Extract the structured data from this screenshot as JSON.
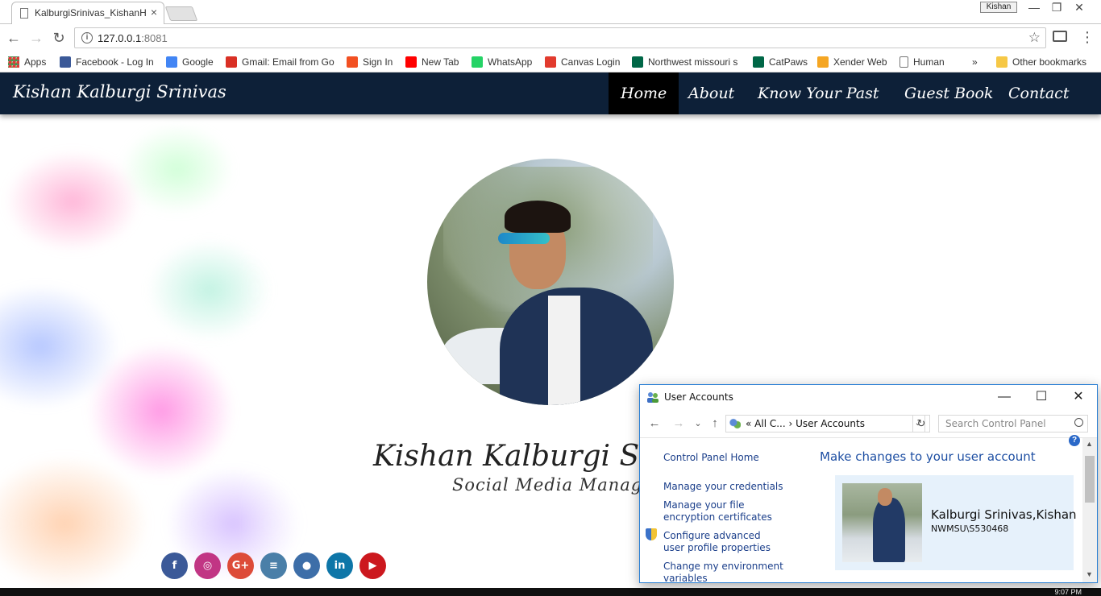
{
  "browser": {
    "tab_title": "KalburgiSrinivas_KishanH",
    "tab_close": "×",
    "profile_name": "Kishan",
    "window_controls": {
      "minimize": "—",
      "maximize": "❐",
      "close": "✕"
    },
    "nav": {
      "back": "←",
      "forward": "→",
      "reload": "↻"
    },
    "info_icon_glyph": "i",
    "url_host": "127.0.0.1",
    "url_port": ":8081",
    "star_glyph": "☆",
    "menu_glyph": "⋮",
    "bookmarks": [
      {
        "label": "Apps",
        "icon": "apps-grid-icon",
        "color": "#e53935"
      },
      {
        "label": "Facebook - Log In",
        "icon": "facebook-icon",
        "color": "#3b5998"
      },
      {
        "label": "Google",
        "icon": "google-icon",
        "color": "#4285f4"
      },
      {
        "label": "Gmail: Email from Go",
        "icon": "gmail-icon",
        "color": "#d93025"
      },
      {
        "label": "Sign In",
        "icon": "microsoft-icon",
        "color": "#f25022"
      },
      {
        "label": "New Tab",
        "icon": "youtube-icon",
        "color": "#ff0000"
      },
      {
        "label": "WhatsApp",
        "icon": "whatsapp-icon",
        "color": "#25d366"
      },
      {
        "label": "Canvas Login",
        "icon": "canvas-icon",
        "color": "#e23b2e"
      },
      {
        "label": "Northwest missouri s",
        "icon": "northwest-icon",
        "color": "#006747"
      },
      {
        "label": "CatPaws",
        "icon": "catpaws-icon",
        "color": "#006747"
      },
      {
        "label": "Xender Web",
        "icon": "xender-icon",
        "color": "#f5a623"
      },
      {
        "label": "Human",
        "icon": "page-icon",
        "color": "#777777"
      },
      {
        "label": "»",
        "icon": "",
        "color": ""
      },
      {
        "label": "Other bookmarks",
        "icon": "folder-icon",
        "color": "#f6c846"
      }
    ]
  },
  "site": {
    "brand": "Kishan Kalburgi Srinivas",
    "nav": [
      "Home",
      "About",
      "Know Your Past",
      "Guest Book",
      "Contact"
    ],
    "active_nav": "Home",
    "hero_name": "Kishan Kalburgi Sr",
    "hero_role": "Social Media Manage",
    "socials": [
      {
        "name": "facebook",
        "glyph": "f",
        "color": "#3b5998"
      },
      {
        "name": "instagram",
        "glyph": "◎",
        "color": "#c13584"
      },
      {
        "name": "google-plus",
        "glyph": "G+",
        "color": "#dd4b39"
      },
      {
        "name": "bucket",
        "glyph": "≡",
        "color": "#4a7fa8"
      },
      {
        "name": "github",
        "glyph": "●",
        "color": "#3d6ea8"
      },
      {
        "name": "linkedin",
        "glyph": "in",
        "color": "#0e76a8"
      },
      {
        "name": "youtube",
        "glyph": "▶",
        "color": "#cc181e"
      }
    ]
  },
  "user_accounts": {
    "title": "User Accounts",
    "controls": {
      "minimize": "—",
      "maximize": "☐",
      "close": "✕"
    },
    "nav": {
      "back": "←",
      "forward": "→",
      "recent": "⌄",
      "up": "↑"
    },
    "breadcrumb": "«  All C...  ›  User Accounts",
    "dropdown_glyph": "⌄",
    "refresh_glyph": "↻",
    "search_placeholder": "Search Control Panel",
    "sidebar_links": [
      "Control Panel Home",
      "Manage your credentials",
      "Manage your file encryption certificates",
      "Configure advanced user profile properties",
      "Change my environment variables"
    ],
    "heading": "Make changes to your user account",
    "account_name": "Kalburgi Srinivas,Kishan",
    "account_id": "NWMSU\\S530468",
    "help_glyph": "?",
    "scroll_up": "▲",
    "scroll_down": "▼"
  },
  "taskbar": {
    "clock": "9:07 PM"
  }
}
